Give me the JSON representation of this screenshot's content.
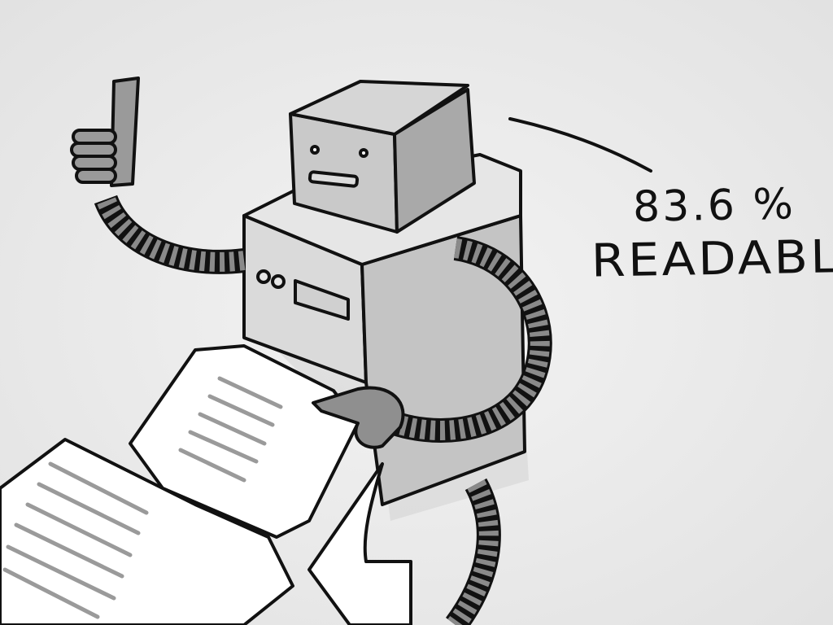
{
  "caption": {
    "percentage": "83.6 %",
    "word": "READABLE"
  },
  "illustration": {
    "subject": "robot-reading-paper-scroll",
    "gesture": "thumbs-up-icon",
    "colors": {
      "background": "#ececec",
      "ink": "#111111",
      "body_light": "#d9d9d9",
      "body_mid": "#b8b8b8",
      "body_dark": "#8c8c8c",
      "paper": "#ffffff",
      "text_lines": "#9a9a9a"
    }
  }
}
